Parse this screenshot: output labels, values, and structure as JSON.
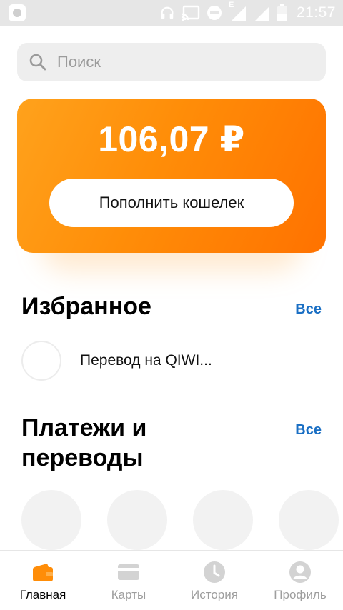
{
  "status_bar": {
    "time": "21:57",
    "network_letter": "E"
  },
  "search": {
    "placeholder": "Поиск"
  },
  "balance": {
    "amount": "106,07 ₽",
    "topup_label": "Пополнить кошелек"
  },
  "favorites": {
    "title": "Избранное",
    "see_all": "Все",
    "items": [
      {
        "label": "Перевод на QIWI..."
      }
    ]
  },
  "payments": {
    "title_line1": "Платежи и",
    "title_line2": "переводы",
    "see_all": "Все"
  },
  "bottom_nav": {
    "items": [
      {
        "label": "Главная",
        "icon": "wallet-icon",
        "active": true
      },
      {
        "label": "Карты",
        "icon": "card-icon",
        "active": false
      },
      {
        "label": "История",
        "icon": "clock-icon",
        "active": false
      },
      {
        "label": "Профиль",
        "icon": "profile-icon",
        "active": false
      }
    ]
  },
  "colors": {
    "accent_orange": "#ff8d08",
    "link_blue": "#1a6fc4",
    "status_bar": "#e6e6e6"
  }
}
